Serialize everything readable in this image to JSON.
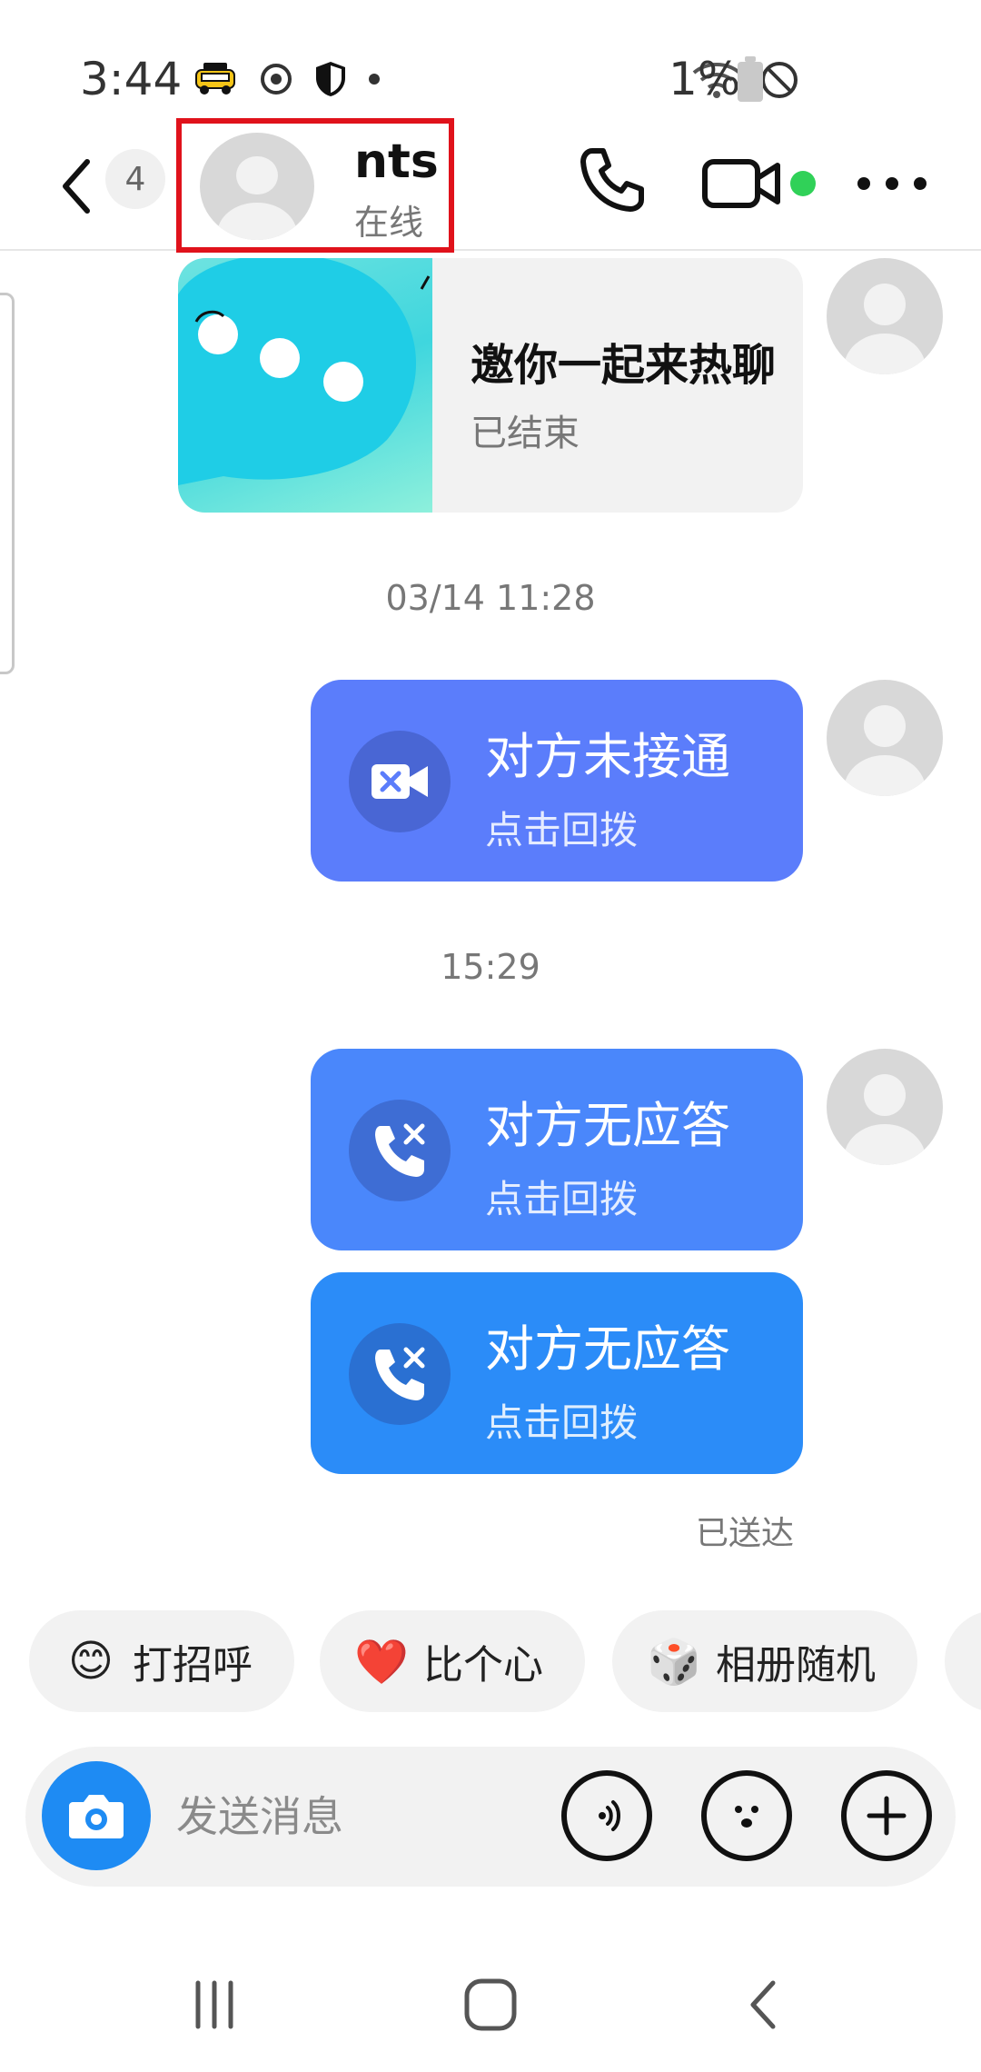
{
  "status_bar": {
    "time": "3:44",
    "battery": "1%",
    "icons": [
      "taxi-icon",
      "sync-icon",
      "shield-icon",
      "dot-icon",
      "wifi-icon",
      "do-not-disturb-icon",
      "battery-icon"
    ]
  },
  "header": {
    "back_icon": "chevron-left-icon",
    "unread_count": "4",
    "contact_name": "nts",
    "contact_status": "在线",
    "phone_icon": "phone-icon",
    "video_icon": "video-icon",
    "online_color": "#30d158",
    "more_icon": "more-icon"
  },
  "messages": {
    "invite_card": {
      "title": "邀你一起来热聊",
      "status": "已结束"
    },
    "time_1": "03/14 11:28",
    "call_1": {
      "title": "对方未接通",
      "action": "点击回拨",
      "color": "#5b7dfb",
      "icon": "video-off-icon"
    },
    "time_2": "15:29",
    "call_2": {
      "title": "对方无应答",
      "action": "点击回拨",
      "color": "#4a87fb",
      "icon": "phone-missed-icon"
    },
    "call_3": {
      "title": "对方无应答",
      "action": "点击回拨",
      "color": "#2b8cf8",
      "icon": "phone-missed-icon"
    },
    "delivered": "已送达"
  },
  "quick_replies": [
    {
      "emoji": "😊",
      "label": "打招呼"
    },
    {
      "emoji": "❤️",
      "label": "比个心"
    },
    {
      "emoji": "🎲",
      "label": "相册随机"
    }
  ],
  "composer": {
    "placeholder": "发送消息",
    "camera_color": "#1e8bf3"
  },
  "nav": [
    "recent-apps-icon",
    "home-icon",
    "back-icon"
  ]
}
